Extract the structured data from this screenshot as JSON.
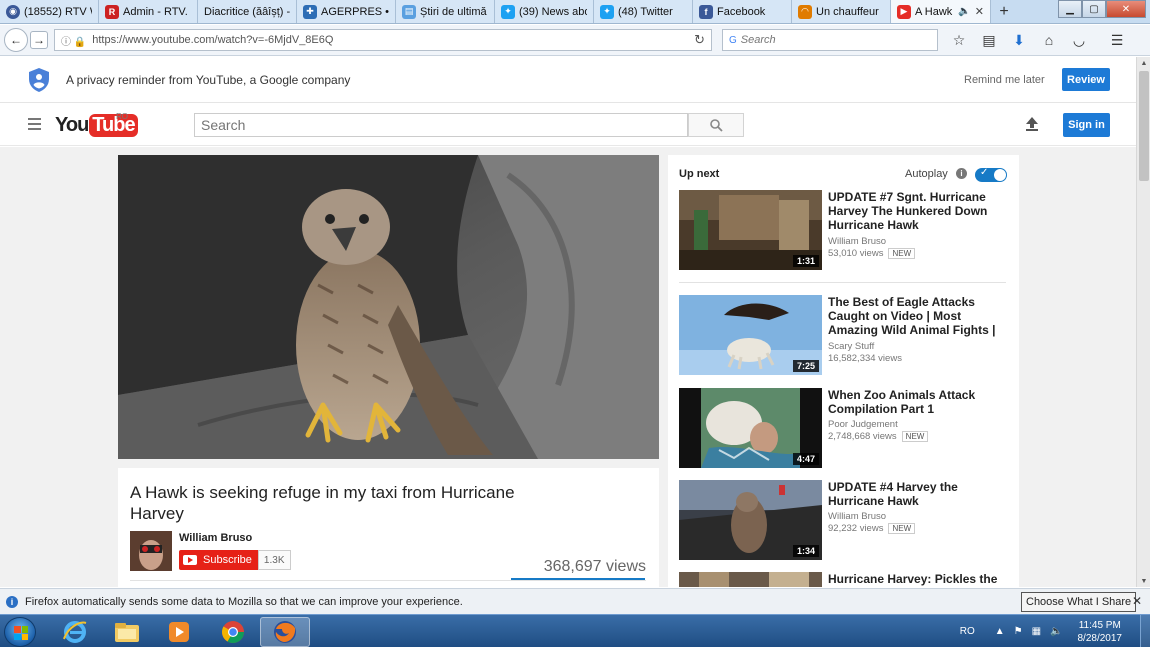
{
  "browser": {
    "tabs": [
      {
        "label": "(18552) RTV W",
        "icon_color": "#3b5998",
        "icon": "app-icon"
      },
      {
        "label": "Admin - RTV.",
        "icon_color": "#cc2222",
        "icon": "R"
      },
      {
        "label": "Diacritice (ăâîșț) -",
        "icon_color": "#d6e6f6",
        "icon": ""
      },
      {
        "label": "AGERPRES • A",
        "icon_color": "#2d6db5",
        "icon": "puzzle-icon"
      },
      {
        "label": "Știri de ultimă",
        "icon_color": "#5aa0e0",
        "icon": "page-icon"
      },
      {
        "label": "(39) News abo",
        "icon_color": "#1da1f2",
        "icon": "twitter-icon"
      },
      {
        "label": "(48) Twitter",
        "icon_color": "#1da1f2",
        "icon": "twitter-icon"
      },
      {
        "label": "Facebook",
        "icon_color": "#3b5998",
        "icon": "f"
      },
      {
        "label": "Un chauffeur",
        "icon_color": "#e07b00",
        "icon": "rss-icon"
      },
      {
        "label": "A Hawk",
        "icon_color": "#e52d27",
        "icon": "youtube-icon",
        "active": true
      }
    ],
    "url": "https://www.youtube.com/watch?v=-6MjdV_8E6Q",
    "search_placeholder": "Search"
  },
  "privacy": {
    "text": "A privacy reminder from YouTube, a Google company",
    "remind_label": "Remind me later",
    "review_label": "Review"
  },
  "youtube": {
    "logo_you": "You",
    "logo_tube": "Tube",
    "region": "RO",
    "search_placeholder": "Search",
    "signin_label": "Sign in"
  },
  "video": {
    "title": "A Hawk is seeking refuge in my taxi from Hurricane Harvey",
    "channel": "William Bruso",
    "subscribe_label": "Subscribe",
    "subscriber_count": "1.3K",
    "views": "368,697 views"
  },
  "upnext": {
    "heading": "Up next",
    "autoplay_label": "Autoplay",
    "items": [
      {
        "title": "UPDATE #7 Sgnt. Hurricane Harvey The Hunkered Down Hurricane Hawk",
        "channel": "William Bruso",
        "views": "53,010 views",
        "badge": "NEW",
        "duration": "1:31"
      },
      {
        "title": "The Best of Eagle Attacks Caught on Video | Most Amazing Wild Animal Fights |",
        "channel": "Scary Stuff",
        "views": "16,582,334 views",
        "badge": "",
        "duration": "7:25"
      },
      {
        "title": "When Zoo Animals Attack Compilation Part 1",
        "channel": "Poor Judgement",
        "views": "2,748,668 views",
        "badge": "NEW",
        "duration": "4:47"
      },
      {
        "title": "UPDATE #4 Harvey the Hurricane Hawk",
        "channel": "William Bruso",
        "views": "92,232 views",
        "badge": "NEW",
        "duration": "1:34"
      },
      {
        "title": "Hurricane Harvey: Pickles the",
        "channel": "",
        "views": "",
        "badge": "",
        "duration": ""
      }
    ]
  },
  "notification": {
    "text": "Firefox automatically sends some data to Mozilla so that we can improve your experience.",
    "button_label": "Choose What I Share"
  },
  "taskbar": {
    "language": "RO",
    "time": "11:45 PM",
    "date": "8/28/2017"
  }
}
